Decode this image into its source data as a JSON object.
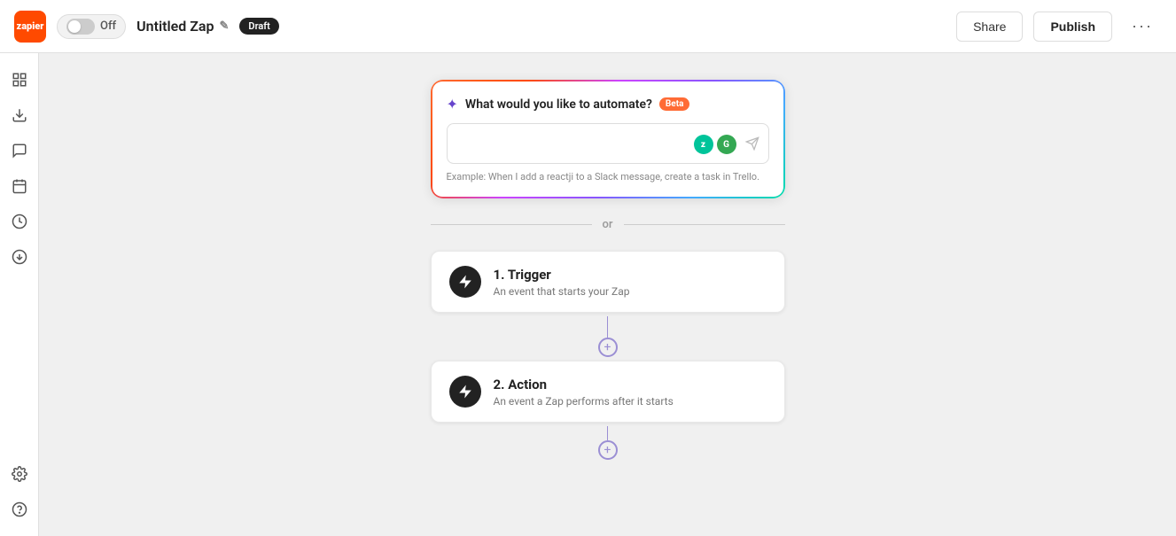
{
  "header": {
    "logo_text": "zapier",
    "toggle_label": "Off",
    "zap_title": "Untitled Zap",
    "edit_icon": "✎",
    "draft_badge": "Draft",
    "share_label": "Share",
    "publish_label": "Publish",
    "more_icon": "···"
  },
  "sidebar": {
    "items": [
      {
        "name": "grid-icon",
        "symbol": "⊞",
        "label": "Apps"
      },
      {
        "name": "download-icon",
        "symbol": "⬇",
        "label": "Import"
      },
      {
        "name": "chat-icon",
        "symbol": "💬",
        "label": "Comments"
      },
      {
        "name": "calendar-icon",
        "symbol": "📅",
        "label": "Schedule"
      },
      {
        "name": "history-icon",
        "symbol": "🕐",
        "label": "History"
      },
      {
        "name": "download2-icon",
        "symbol": "⬇",
        "label": "Download"
      },
      {
        "name": "settings-icon",
        "symbol": "⚙",
        "label": "Settings"
      },
      {
        "name": "help-icon",
        "symbol": "?",
        "label": "Help"
      }
    ]
  },
  "ai_card": {
    "spark_icon": "✦",
    "question": "What would you like to automate?",
    "beta_label": "Beta",
    "input_placeholder": "",
    "icon_teal": "z",
    "icon_green": "G",
    "send_icon": "➤",
    "example_text": "Example: When I add a reactji to a Slack message, create a task in Trello."
  },
  "or_divider": {
    "text": "or"
  },
  "steps": [
    {
      "number": "1.",
      "title": "Trigger",
      "description": "An event that starts your Zap",
      "icon": "bolt"
    },
    {
      "number": "2.",
      "title": "Action",
      "description": "An event a Zap performs after it starts",
      "icon": "bolt"
    }
  ],
  "connector": {
    "plus_symbol": "+"
  }
}
